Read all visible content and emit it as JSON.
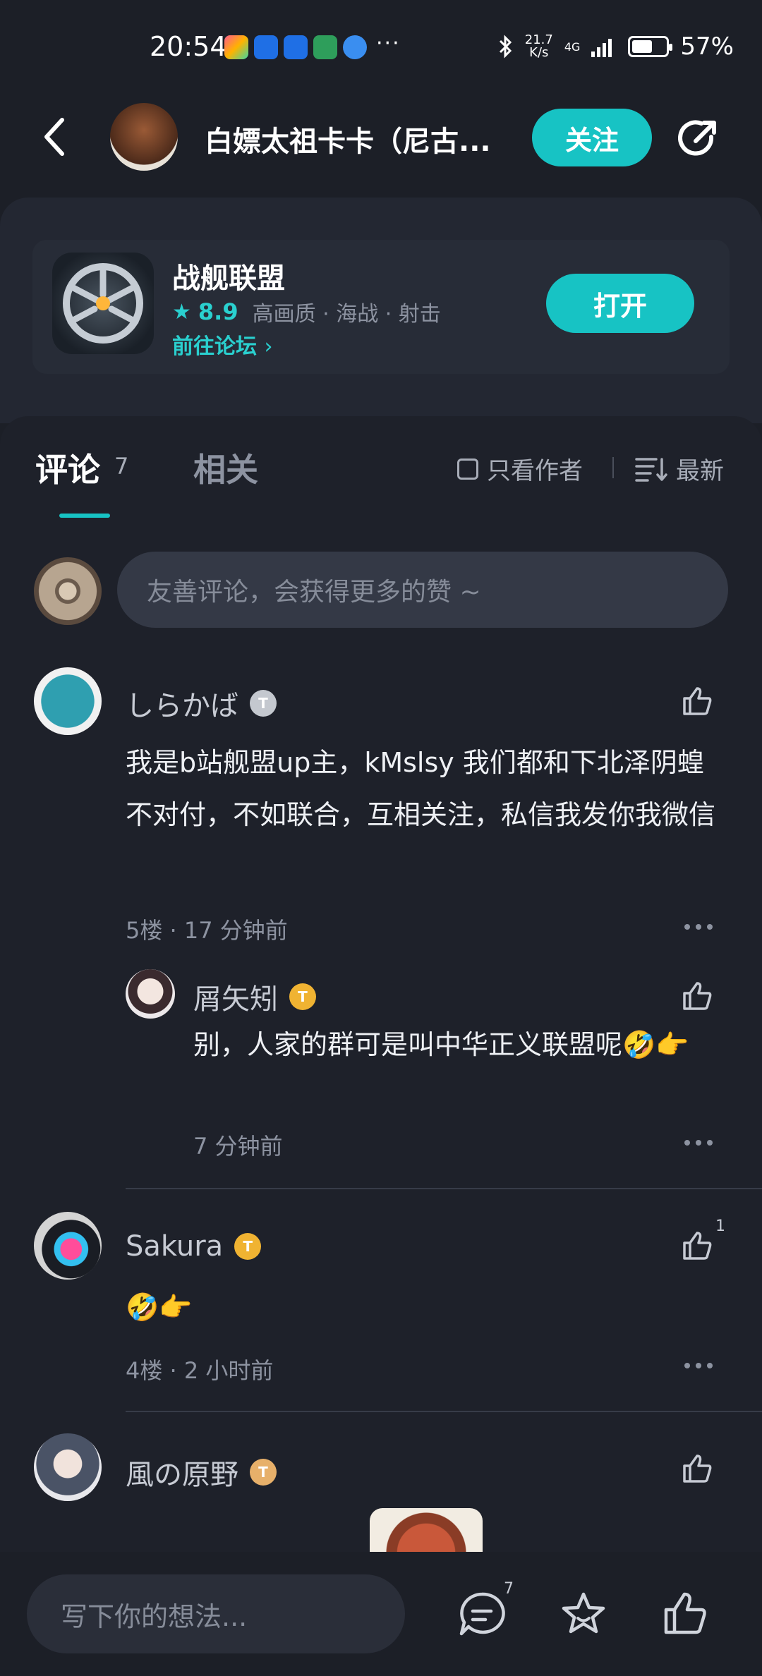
{
  "status": {
    "time": "20:54",
    "more": "···",
    "net_speed_value": "21.7",
    "net_speed_unit": "K/s",
    "signal": "4G",
    "battery": "57%"
  },
  "header": {
    "author": "白嫖太祖卡卡（尼古...",
    "follow": "关注"
  },
  "game": {
    "title": "战舰联盟",
    "rating": "8.9",
    "tags": "高画质 · 海战 · 射击",
    "forum_link": "前往论坛",
    "open": "打开"
  },
  "tabs": {
    "comments": "评论",
    "comments_count": "7",
    "related": "相关",
    "only_author": "只看作者",
    "sort": "最新"
  },
  "comment_input_placeholder": "友善评论，会获得更多的赞 ~",
  "comments": [
    {
      "user": "しらかば",
      "badge": "T",
      "text": "我是b站舰盟up主，kMslsy 我们都和下北泽阴蝗不对付，不如联合，互相关注，私信我发你我微信",
      "meta": "5楼 · 17 分钟前",
      "reply": {
        "user": "屑矢矧",
        "badge": "T",
        "text": "别，人家的群可是叫中华正义联盟呢🤣👉",
        "meta": "7 分钟前"
      }
    },
    {
      "user": "Sakura",
      "badge": "T",
      "text": "🤣👉",
      "meta": "4楼 · 2 小时前",
      "likes": "1"
    },
    {
      "user": "風の原野",
      "badge": "T"
    }
  ],
  "bottom": {
    "placeholder": "写下你的想法...",
    "comment_count": "7"
  },
  "colors": {
    "accent": "#17c3c4",
    "background": "#1c1f27"
  }
}
